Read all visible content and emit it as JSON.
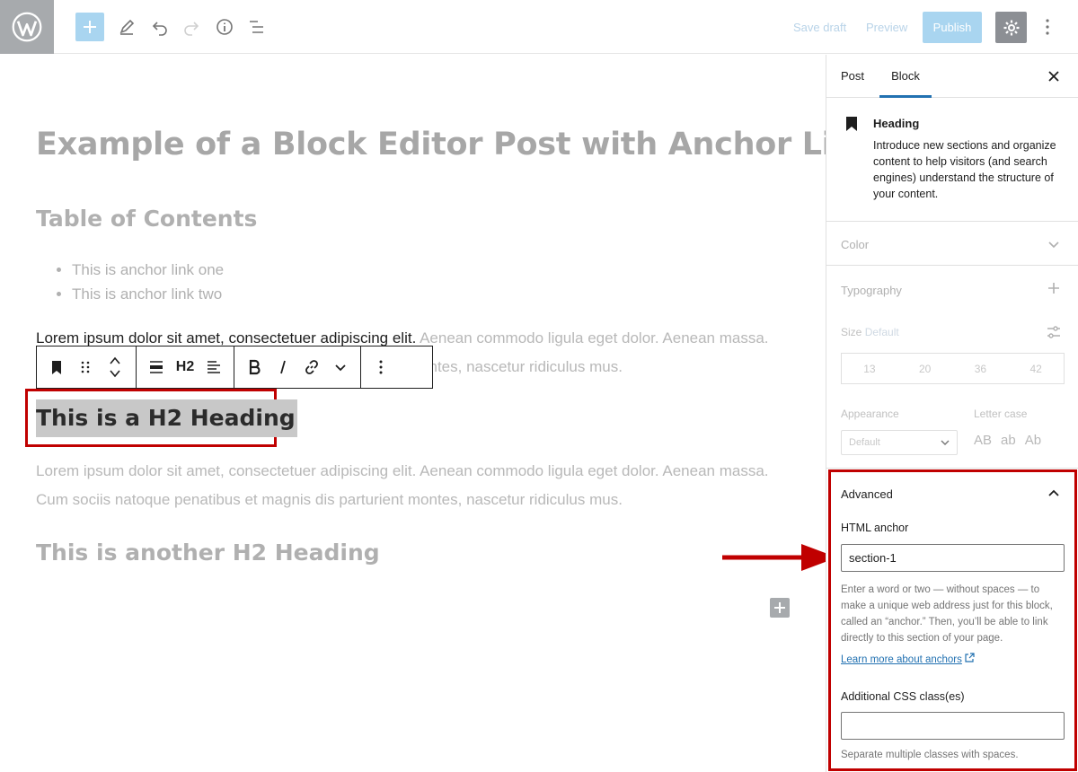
{
  "topbar": {
    "save_draft": "Save draft",
    "preview": "Preview",
    "publish": "Publish"
  },
  "post": {
    "title": "Example of a Block Editor Post with Anchor Links",
    "toc_heading": "Table of Contents",
    "toc_items": [
      "This is anchor link one",
      "This is anchor link two"
    ],
    "para1_active": "Lorem ipsum dolor sit amet, consectetuer adipiscing elit.",
    "para1_rest": " Aenean commodo ligula eget dolor. Aenean massa. Cum sociis natoque penatibus et magnis dis parturient montes, nascetur ridiculus mus.",
    "h2_selected": "This is a H2 Heading",
    "para2": "Lorem ipsum dolor sit amet, consectetuer adipiscing elit. Aenean commodo ligula eget dolor. Aenean massa. Cum sociis natoque penatibus et magnis dis parturient montes, nascetur ridiculus mus.",
    "h2_another": "This is another H2 Heading"
  },
  "block_toolbar": {
    "heading_level": "H2"
  },
  "sidebar": {
    "tabs": {
      "post": "Post",
      "block": "Block"
    },
    "block_card": {
      "title": "Heading",
      "description": "Introduce new sections and organize content to help visitors (and search engines) understand the structure of your content."
    },
    "color": "Color",
    "typography": "Typography",
    "size_label": "Size",
    "size_value": "Default",
    "size_options": [
      "13",
      "20",
      "36",
      "42"
    ],
    "appearance_label": "Appearance",
    "appearance_value": "Default",
    "letter_case_label": "Letter case",
    "letter_case_options": [
      "AB",
      "ab",
      "Ab"
    ],
    "advanced": {
      "title": "Advanced",
      "html_anchor_label": "HTML anchor",
      "html_anchor_value": "section-1",
      "html_anchor_help": "Enter a word or two — without spaces — to make a unique web address just for this block, called an “anchor.” Then, you’ll be able to link directly to this section of your page.",
      "learn_more": "Learn more about anchors",
      "css_label": "Additional CSS class(es)",
      "css_value": "",
      "css_help": "Separate multiple classes with spaces."
    }
  },
  "colors": {
    "accent": "#2271b1",
    "highlight_red": "#c00000"
  }
}
